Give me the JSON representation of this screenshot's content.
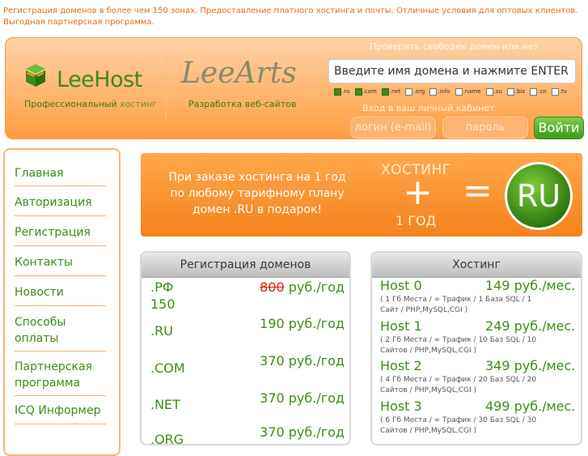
{
  "tagline": "Регистрация доменов в более чем 150 зонах. Предоставление платного хостинга и почты. Отличные условия для оптовых клиентов. Выгодная партнерская программа.",
  "brand": {
    "name": "LeeHost",
    "slogan_pro": "Профессиональный",
    "slogan_host": "хостинг",
    "partner_logo": "LeeArts",
    "partner_slogan": "Разработка веб-сайтов"
  },
  "domain_check": {
    "label": "Проверить свободен домен или нет",
    "value": "Введите имя домена и нажмите ENTER",
    "zones": [
      {
        "name": ".ru",
        "checked": true
      },
      {
        "name": ".com",
        "checked": true
      },
      {
        "name": ".net",
        "checked": true
      },
      {
        "name": ".org",
        "checked": false
      },
      {
        "name": ".info",
        "checked": false
      },
      {
        "name": ".name",
        "checked": false
      },
      {
        "name": ".su",
        "checked": false
      },
      {
        "name": ".biz",
        "checked": false
      },
      {
        "name": ".cn",
        "checked": false
      },
      {
        "name": ".tv",
        "checked": false
      }
    ]
  },
  "login": {
    "label": "Вход в ваш личный кабинет",
    "login_placeholder": "логин (e-mail)",
    "password_placeholder": "пароль",
    "submit": "Войти"
  },
  "nav": [
    "Главная",
    "Авторизация",
    "Регистрация",
    "Контакты",
    "Новости",
    "Способы оплаты",
    "Партнерская программа",
    "ICQ Информер"
  ],
  "banner": {
    "promo": "При заказе хостинга на 1 год по любому тарифному плану домен .RU в подарок!",
    "hosting": "ХОСТИНГ",
    "plus": "+",
    "year": "1 ГОД",
    "equals": "=",
    "ru": "RU"
  },
  "domains": {
    "title": "Регистрация доменов",
    "rows": [
      {
        "name": ".РФ",
        "old_price": "800",
        "price": "руб./год",
        "extra": "150"
      },
      {
        "name": ".RU",
        "price": "190 руб./год"
      },
      {
        "name": ".COM",
        "price": "370 руб./год"
      },
      {
        "name": ".NET",
        "price": "370 руб./год"
      },
      {
        "name": ".ORG",
        "price": "370 руб./год"
      }
    ]
  },
  "hosting": {
    "title": "Хостинг",
    "plans": [
      {
        "name": "Host 0",
        "price": "149 руб./мес.",
        "desc": "( 1 Гб Места / ∞ Трафик / 1 База SQL / 1 Сайт / PHP,MySQL,CGI )"
      },
      {
        "name": "Host 1",
        "price": "249 руб./мес.",
        "desc": "( 2 Гб Места / ∞ Трафик / 10 Баз SQL / 10 Сайтов / PHP,MySQL,CGI )"
      },
      {
        "name": "Host 2",
        "price": "349 руб./мес.",
        "desc": "( 4 Гб Места / ∞ Трафик / 20 Баз SQL / 20 Сайтов / PHP,MySQL,CGI )"
      },
      {
        "name": "Host 3",
        "price": "499 руб./мес.",
        "desc": "( 6 Гб Места / ∞ Трафик / 30 Баз SQL / 30 Сайтов / PHP,MySQL,CGI )"
      }
    ]
  }
}
